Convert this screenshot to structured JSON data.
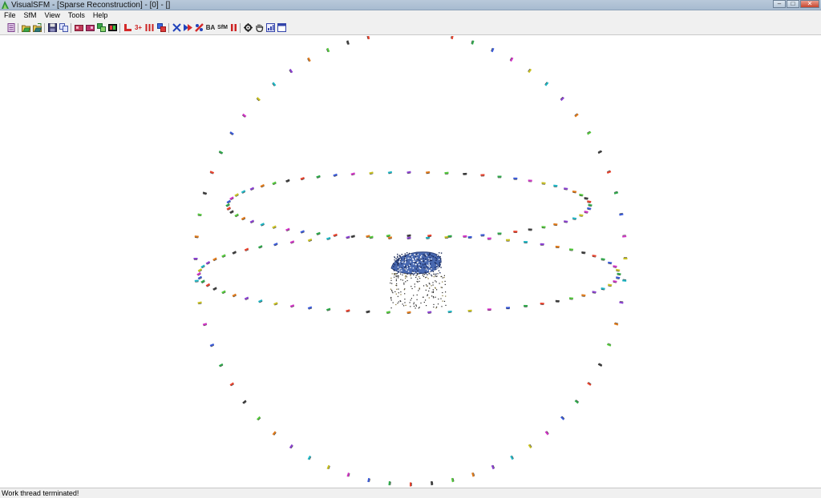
{
  "window": {
    "title": "VisualSFM - [Sparse Reconstruction] - [0] - []",
    "controls": {
      "minimize": "–",
      "maximize": "□",
      "close": "✕"
    }
  },
  "menu": {
    "items": [
      "File",
      "SfM",
      "View",
      "Tools",
      "Help"
    ]
  },
  "toolbar": {
    "buttons": [
      {
        "name": "open-log-icon",
        "color": "#7a3e8a"
      },
      {
        "name": "open-images-icon",
        "color": "#2c7a2c"
      },
      {
        "name": "open-multi-icon",
        "color": "#2c7a2c"
      },
      {
        "name": "save-icon",
        "color": "#222255"
      },
      {
        "name": "copy-icon",
        "color": "#4455aa"
      },
      {
        "name": "feature-icon",
        "color": "#aa2244"
      },
      {
        "name": "match-icon",
        "color": "#aa2266"
      },
      {
        "name": "pairs-icon",
        "color": "#228844"
      },
      {
        "name": "view-icon",
        "color": "#aa3333"
      },
      {
        "name": "reconstruct-icon",
        "color": "#cc2222"
      },
      {
        "name": "compute-3plus-icon",
        "color": "#cc2222"
      },
      {
        "name": "compute-missing-icon",
        "color": "#cc2222"
      },
      {
        "name": "run-dense-icon",
        "color": "#2255cc"
      },
      {
        "name": "expand-icon",
        "color": "#2244bb"
      },
      {
        "name": "next-icon",
        "color": "#2244bb"
      },
      {
        "name": "merge-icon",
        "color": "#cc2222"
      },
      {
        "name": "bundle-adjust-icon",
        "color": "#222222"
      },
      {
        "name": "cmvs-icon",
        "color": "#222222"
      },
      {
        "name": "pause-icon",
        "color": "#cc2222"
      },
      {
        "name": "gear-icon",
        "color": "#222222"
      },
      {
        "name": "hand-icon",
        "color": "#333333"
      },
      {
        "name": "chart-icon",
        "color": "#3344aa"
      },
      {
        "name": "window-icon",
        "color": "#3344aa"
      }
    ],
    "text_labels": {
      "ba": "BA",
      "sfm": "SfM",
      "three_plus": "3+"
    }
  },
  "scene": {
    "colors": [
      "#e8412c",
      "#2ea84a",
      "#3a5ad8",
      "#d033c4",
      "#c8c020",
      "#1fb6c4",
      "#8a3fd0",
      "#e07a1a",
      "#52c83a",
      "#3a3a3a"
    ],
    "object_color": "#4868b0"
  },
  "status": {
    "text": "Work thread terminated!"
  }
}
